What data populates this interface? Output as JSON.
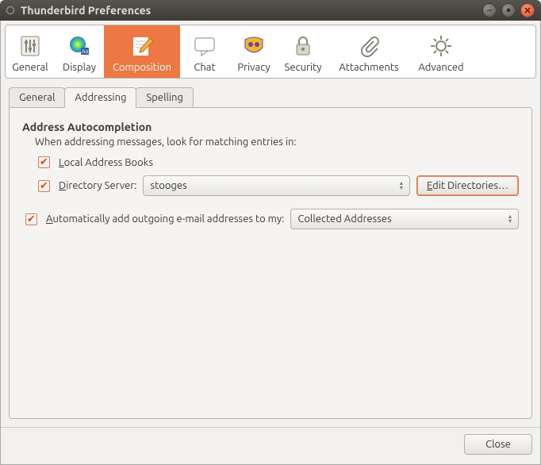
{
  "window": {
    "title": "Thunderbird Preferences"
  },
  "toolbar": {
    "items": [
      {
        "label": "General"
      },
      {
        "label": "Display"
      },
      {
        "label": "Composition"
      },
      {
        "label": "Chat"
      },
      {
        "label": "Privacy"
      },
      {
        "label": "Security"
      },
      {
        "label": "Attachments"
      },
      {
        "label": "Advanced"
      }
    ],
    "active_index": 2
  },
  "subtabs": {
    "items": [
      {
        "label": "General"
      },
      {
        "label": "Addressing"
      },
      {
        "label": "Spelling"
      }
    ],
    "active_index": 1
  },
  "addressing": {
    "section_title": "Address Autocompletion",
    "description": "When addressing messages, look for matching entries in:",
    "local_label_pre": "L",
    "local_label_rest": "ocal Address Books",
    "local_checked": true,
    "dirserver_label_pre": "D",
    "dirserver_label_rest": "irectory Server:",
    "dirserver_checked": true,
    "dirserver_selected": "stooges",
    "edit_button_pre": "E",
    "edit_button_rest": "dit Directories…",
    "auto_label_pre": "A",
    "auto_label_rest": "utomatically add outgoing e-mail addresses to my:",
    "auto_checked": true,
    "auto_selected": "Collected Addresses"
  },
  "footer": {
    "close_label": "Close"
  }
}
